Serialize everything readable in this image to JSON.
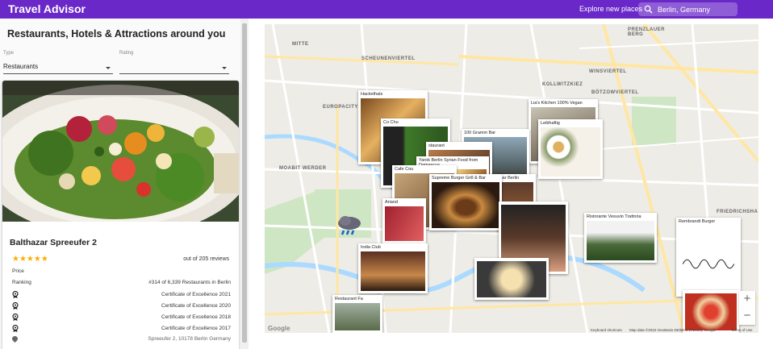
{
  "appbar": {
    "title": "Travel Advisor",
    "explore_label": "Explore new places",
    "search_value": "Berlin, Germany",
    "color": "#6a28c8"
  },
  "panel": {
    "heading": "Restaurants, Hotels & Attractions around you",
    "type_label": "Type",
    "type_value": "Restaurants",
    "rating_label": "Rating",
    "rating_value": ""
  },
  "place": {
    "name": "Balthazar Spreeufer 2",
    "rating_stars": 5,
    "stars_text": "★★★★★",
    "reviews": "out of 205 reviews",
    "price_label": "Price",
    "ranking_label": "Ranking",
    "ranking_value": "#314 of 6,339 Restaurants in Berlin",
    "awards": [
      "Certificate of Excellence 2021",
      "Certificate of Excellence 2020",
      "Certificate of Excellence 2018",
      "Certificate of Excellence 2017"
    ],
    "address": "Spreeufer 2, 10178 Berlin Germany"
  },
  "map": {
    "districts": [
      "MITTE",
      "SCHEUNENVIERTEL",
      "EUROPACITY",
      "MOABIT WERDER",
      "KOLLWITZKIEZ",
      "WINSVIERTEL",
      "BÖTZOWVIERTEL",
      "PRENZLAUER BERG",
      "FRIEDRICHSHA"
    ],
    "markers": [
      "Hackethals",
      "Lia's Kitchen 100% Vegan",
      "Co Chu",
      "Leibhaftig",
      "100 Gramm Bar",
      "staurant",
      "Yarok Berlin Syrian Food from Damascus",
      "Cafe Cou",
      "Supreme Burger Grill & Bar",
      "Bar Berlin",
      "Ariand",
      "India Club",
      "Ristorante Vesuvio Trattoria",
      "Rembrandt Burger",
      "Restaurant Fa"
    ],
    "zoom_in": "+",
    "zoom_out": "−",
    "logo": "Google",
    "footer_shortcuts": "Keyboard shortcuts",
    "footer_data": "Map data ©2022 GeoBasis-DE/BKG (©2009), Google",
    "footer_terms": "Terms of Use"
  }
}
